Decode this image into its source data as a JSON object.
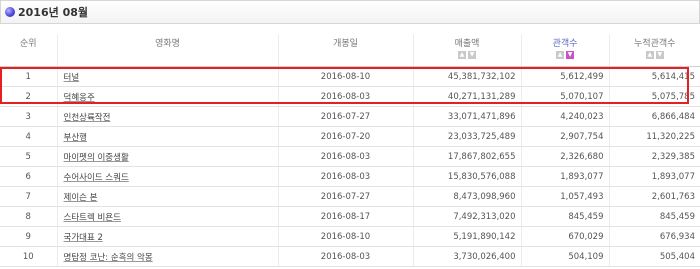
{
  "header": {
    "title": "2016년 08월"
  },
  "columns": {
    "rank": "순위",
    "title": "영화명",
    "release": "개봉일",
    "sales": "매출액",
    "audience": "관객수",
    "cumulative": "누적관객수",
    "sort_asc": "▲",
    "sort_desc": "▼"
  },
  "rows": [
    {
      "rank": "1",
      "title": "터널",
      "release": "2016-08-10",
      "sales": "45,381,732,102",
      "audience": "5,612,499",
      "cumulative": "5,614,415"
    },
    {
      "rank": "2",
      "title": "덕혜옹주",
      "release": "2016-08-03",
      "sales": "40,271,131,289",
      "audience": "5,070,107",
      "cumulative": "5,075,785"
    },
    {
      "rank": "3",
      "title": "인천상륙작전",
      "release": "2016-07-27",
      "sales": "33,071,471,896",
      "audience": "4,240,023",
      "cumulative": "6,866,484"
    },
    {
      "rank": "4",
      "title": "부산행",
      "release": "2016-07-20",
      "sales": "23,033,725,489",
      "audience": "2,907,754",
      "cumulative": "11,320,225"
    },
    {
      "rank": "5",
      "title": "마이펫의 이중생활",
      "release": "2016-08-03",
      "sales": "17,867,802,655",
      "audience": "2,326,680",
      "cumulative": "2,329,385"
    },
    {
      "rank": "6",
      "title": "수어사이드 스쿼드",
      "release": "2016-08-03",
      "sales": "15,830,576,088",
      "audience": "1,893,077",
      "cumulative": "1,893,077"
    },
    {
      "rank": "7",
      "title": "제이슨 본",
      "release": "2016-07-27",
      "sales": "8,473,098,960",
      "audience": "1,057,493",
      "cumulative": "2,601,763"
    },
    {
      "rank": "8",
      "title": "스타트렉 비욘드",
      "release": "2016-08-17",
      "sales": "7,492,313,020",
      "audience": "845,459",
      "cumulative": "845,459"
    },
    {
      "rank": "9",
      "title": "국가대표 2",
      "release": "2016-08-10",
      "sales": "5,191,890,142",
      "audience": "670,029",
      "cumulative": "676,934"
    },
    {
      "rank": "10",
      "title": "명탐정 코난: 순흑의 악몽",
      "release": "2016-08-03",
      "sales": "3,730,026,400",
      "audience": "504,109",
      "cumulative": "505,404"
    }
  ],
  "colors": {
    "highlight_border": "#e52020",
    "sort_active": "#c455c9",
    "bullet": "#4a44d6"
  }
}
